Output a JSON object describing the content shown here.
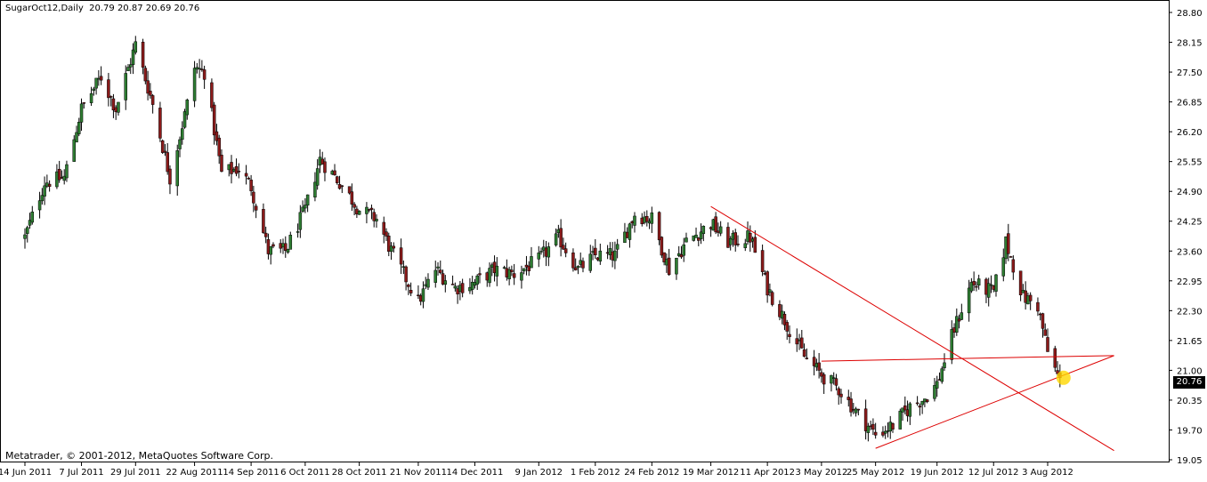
{
  "header": {
    "symbol": "SugarOct12,Daily",
    "ohlc": "20.79 20.87 20.69 20.76"
  },
  "footer": {
    "copyright": "Metatrader, © 2001-2012, MetaQuotes Software Corp."
  },
  "current_price_label": "20.76",
  "colors": {
    "bull": "#2e7d32",
    "bear": "#8b1a1a",
    "trendline": "#dd0000",
    "highlight": "#ffd700",
    "frame": "#000000"
  },
  "chart_data": {
    "type": "candlestick",
    "title": "SugarOct12,Daily",
    "ylim": [
      19.05,
      28.8
    ],
    "y_ticks": [
      "28.80",
      "28.15",
      "27.50",
      "26.85",
      "26.20",
      "25.55",
      "24.90",
      "24.25",
      "23.60",
      "22.95",
      "22.30",
      "21.65",
      "21.00",
      "20.35",
      "19.70",
      "19.05"
    ],
    "x_ticks": [
      "14 Jun 2011",
      "7 Jul 2011",
      "29 Jul 2011",
      "22 Aug 2011",
      "14 Sep 2011",
      "6 Oct 2011",
      "28 Oct 2011",
      "21 Nov 2011",
      "14 Dec 2011",
      "9 Jan 2012",
      "1 Feb 2012",
      "24 Feb 2012",
      "19 Mar 2012",
      "11 Apr 2012",
      "3 May 2012",
      "25 May 2012",
      "19 Jun 2012",
      "12 Jul 2012",
      "3 Aug 2012"
    ],
    "close_path": [
      [
        "14 Jun 2011",
        23.9
      ],
      [
        "22 Jun 2011",
        25.1
      ],
      [
        "30 Jun 2011",
        25.2
      ],
      [
        "7 Jul 2011",
        26.7
      ],
      [
        "15 Jul 2011",
        27.4
      ],
      [
        "21 Jul 2011",
        26.7
      ],
      [
        "29 Jul 2011",
        28.1
      ],
      [
        "5 Aug 2011",
        26.8
      ],
      [
        "12 Aug 2011",
        25.2
      ],
      [
        "19 Aug 2011",
        26.8
      ],
      [
        "22 Aug 2011",
        27.6
      ],
      [
        "26 Aug 2011",
        27.5
      ],
      [
        "2 Sep 2011",
        25.3
      ],
      [
        "9 Sep 2011",
        25.4
      ],
      [
        "14 Sep 2011",
        25.0
      ],
      [
        "21 Sep 2011",
        23.6
      ],
      [
        "28 Sep 2011",
        23.6
      ],
      [
        "6 Oct 2011",
        24.5
      ],
      [
        "12 Oct 2011",
        25.6
      ],
      [
        "20 Oct 2011",
        25.1
      ],
      [
        "28 Oct 2011",
        24.5
      ],
      [
        "4 Nov 2011",
        24.3
      ],
      [
        "10 Nov 2011",
        23.6
      ],
      [
        "21 Nov 2011",
        22.5
      ],
      [
        "28 Nov 2011",
        23.2
      ],
      [
        "6 Dec 2011",
        22.8
      ],
      [
        "14 Dec 2011",
        22.9
      ],
      [
        "22 Dec 2011",
        23.2
      ],
      [
        "30 Dec 2011",
        23.1
      ],
      [
        "9 Jan 2012",
        23.4
      ],
      [
        "17 Jan 2012",
        23.9
      ],
      [
        "25 Jan 2012",
        23.2
      ],
      [
        "1 Feb 2012",
        23.5
      ],
      [
        "9 Feb 2012",
        23.5
      ],
      [
        "17 Feb 2012",
        24.4
      ],
      [
        "24 Feb 2012",
        24.3
      ],
      [
        "2 Mar 2012",
        23.2
      ],
      [
        "9 Mar 2012",
        23.8
      ],
      [
        "19 Mar 2012",
        24.2
      ],
      [
        "26 Mar 2012",
        23.8
      ],
      [
        "4 Apr 2012",
        23.9
      ],
      [
        "11 Apr 2012",
        22.8
      ],
      [
        "18 Apr 2012",
        22.1
      ],
      [
        "26 Apr 2012",
        21.3
      ],
      [
        "3 May 2012",
        20.9
      ],
      [
        "10 May 2012",
        20.6
      ],
      [
        "17 May 2012",
        20.1
      ],
      [
        "25 May 2012",
        19.6
      ],
      [
        "1 Jun 2012",
        19.8
      ],
      [
        "8 Jun 2012",
        20.2
      ],
      [
        "14 Jun 2012",
        20.4
      ],
      [
        "19 Jun 2012",
        20.7
      ],
      [
        "26 Jun 2012",
        21.9
      ],
      [
        "3 Jul 2012",
        22.9
      ],
      [
        "12 Jul 2012",
        22.7
      ],
      [
        "17 Jul 2012",
        23.8
      ],
      [
        "24 Jul 2012",
        22.6
      ],
      [
        "30 Jul 2012",
        22.4
      ],
      [
        "3 Aug 2012",
        21.4
      ],
      [
        "8 Aug 2012",
        20.76
      ]
    ],
    "trendlines": [
      {
        "from": [
          "19 Mar 2012",
          24.57
        ],
        "to": [
          "30 Aug 2012",
          19.25
        ]
      },
      {
        "from": [
          "3 May 2012",
          21.2
        ],
        "to": [
          "30 Aug 2012",
          21.32
        ]
      },
      {
        "from": [
          "25 May 2012",
          19.3
        ],
        "to": [
          "30 Aug 2012",
          21.32
        ]
      }
    ]
  }
}
